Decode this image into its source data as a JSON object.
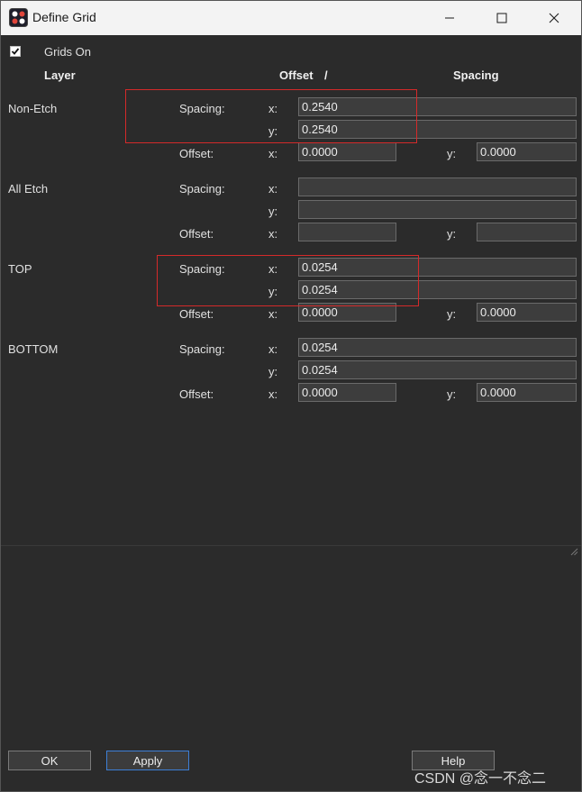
{
  "window": {
    "title": "Define Grid"
  },
  "grids_on": {
    "label": "Grids On",
    "checked": true
  },
  "headers": {
    "layer": "Layer",
    "offset": "Offset",
    "slash": "/",
    "spacing": "Spacing"
  },
  "labels": {
    "spacing": "Spacing:",
    "offset": "Offset:",
    "x": "x:",
    "y": "y:"
  },
  "layers": [
    {
      "name": "Non-Etch",
      "spacing_x": "0.2540",
      "spacing_y": "0.2540",
      "offset_x": "0.0000",
      "offset_y": "0.0000"
    },
    {
      "name": "All Etch",
      "spacing_x": "",
      "spacing_y": "",
      "offset_x": "",
      "offset_y": ""
    },
    {
      "name": "TOP",
      "spacing_x": "0.0254",
      "spacing_y": "0.0254",
      "offset_x": "0.0000",
      "offset_y": "0.0000"
    },
    {
      "name": "BOTTOM",
      "spacing_x": "0.0254",
      "spacing_y": "0.0254",
      "offset_x": "0.0000",
      "offset_y": "0.0000"
    }
  ],
  "buttons": {
    "ok": "OK",
    "apply": "Apply",
    "help": "Help"
  },
  "watermark": "CSDN @念一不念二",
  "colors": {
    "highlight": "#d42a2a",
    "focus": "#3d7fd6",
    "background": "#2b2b2b"
  }
}
